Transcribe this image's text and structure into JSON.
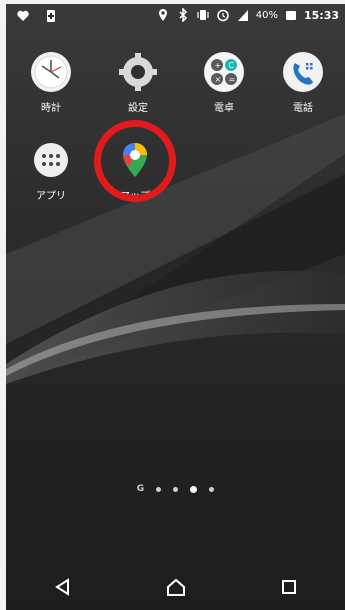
{
  "status_bar": {
    "battery_percent": "40%",
    "time": "15:33"
  },
  "apps": [
    {
      "label": "時計",
      "icon": "clock-icon"
    },
    {
      "label": "設定",
      "icon": "settings-gear-icon"
    },
    {
      "label": "電卓",
      "icon": "calculator-icon"
    },
    {
      "label": "電話",
      "icon": "phone-icon"
    },
    {
      "label": "アプリ",
      "icon": "app-drawer-icon"
    },
    {
      "label": "マップ",
      "icon": "maps-pin-icon"
    }
  ],
  "page_indicator": {
    "first_label": "G",
    "pages": 4,
    "active_index": 2
  },
  "navigation": {
    "back": "back-icon",
    "home": "home-icon",
    "recents": "recents-icon"
  },
  "colors": {
    "highlight": "#e01b1b",
    "wallpaper_dark": "#1d1d1d",
    "text": "#ffffff"
  }
}
